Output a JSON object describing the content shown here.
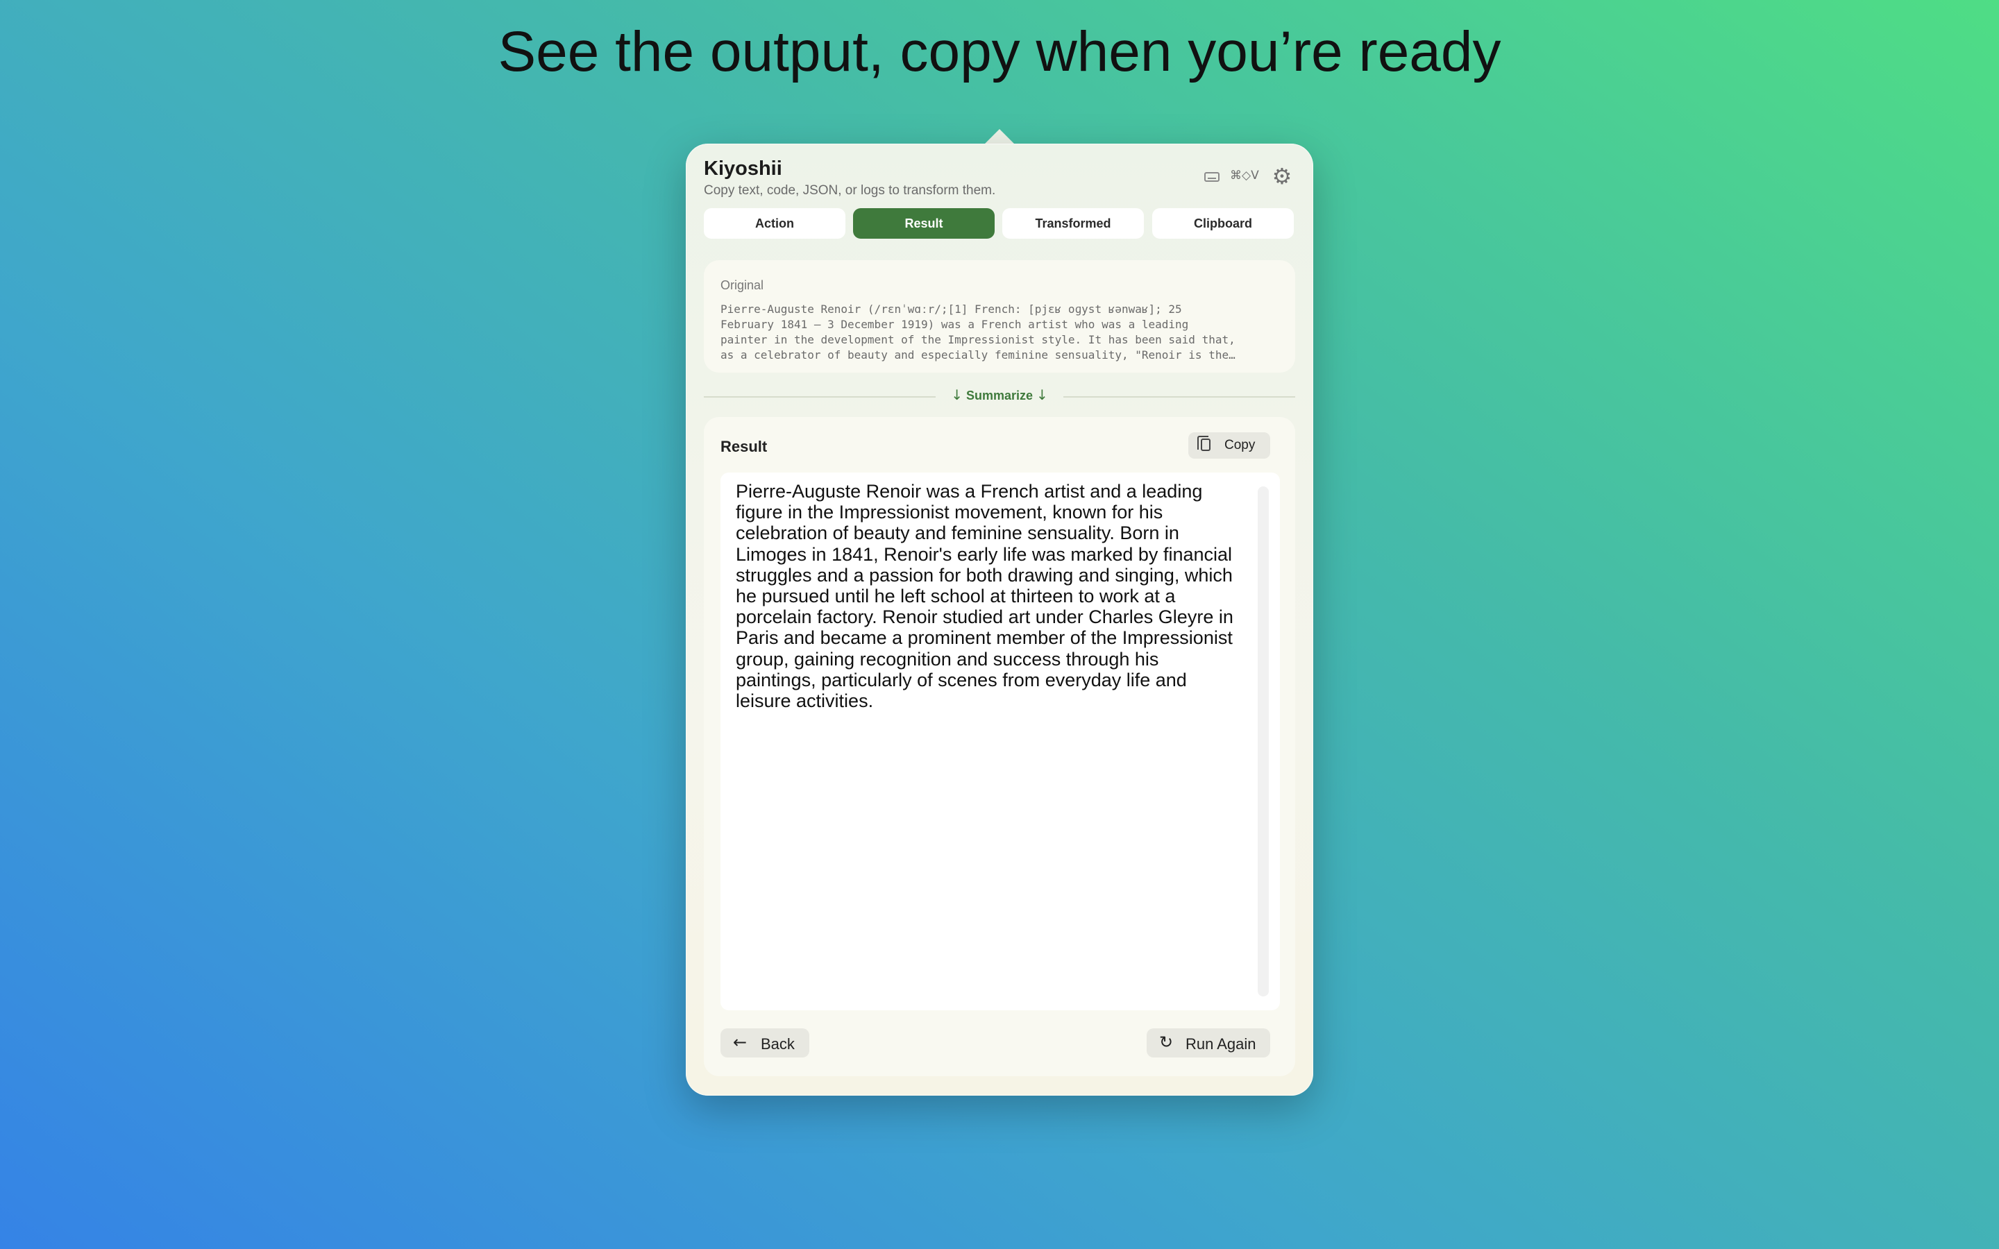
{
  "headline": "See the output, copy when you’re ready",
  "app": {
    "title": "Kiyoshii",
    "subtitle": "Copy text, code, JSON, or logs to transform them.",
    "shortcut": "⌘◇V",
    "icons": [
      "keyboard-icon",
      "gear-icon"
    ]
  },
  "tabs": [
    {
      "label": "Action",
      "active": false
    },
    {
      "label": "Result",
      "active": true
    },
    {
      "label": "Transformed",
      "active": false
    },
    {
      "label": "Clipboard",
      "active": false
    }
  ],
  "original": {
    "label": "Original",
    "lines": [
      "Pierre-Auguste Renoir (/rɛnˈwɑːr/;[1] French: [pjɛʁ oɡyst ʁənwaʁ]; 25",
      "February 1841 – 3 December 1919) was a French artist who was a leading",
      "painter in the development of the Impressionist style. It has been said that,",
      "as a celebrator of beauty and especially feminine sensuality, \"Renoir is the…"
    ]
  },
  "divider": {
    "label": "Summarize"
  },
  "result": {
    "label": "Result",
    "copy_label": "Copy",
    "text": "Pierre-Auguste Renoir was a French artist and a leading figure in the Impressionist movement, known for his celebration of beauty and feminine sensuality. Born in Limoges in 1841, Renoir's early life was marked by financial struggles and a passion for both drawing and singing, which he pursued until he left school at thirteen to work at a porcelain factory. Renoir studied art under Charles Gleyre in Paris and became a prominent member of the Impressionist group, gaining recognition and success through his paintings, particularly of scenes from everyday life and leisure activities."
  },
  "footer": {
    "back_label": "Back",
    "run_again_label": "Run Again"
  },
  "colors": {
    "accent": "#3f7a3c",
    "panel_bg": "#f5f5ec"
  }
}
